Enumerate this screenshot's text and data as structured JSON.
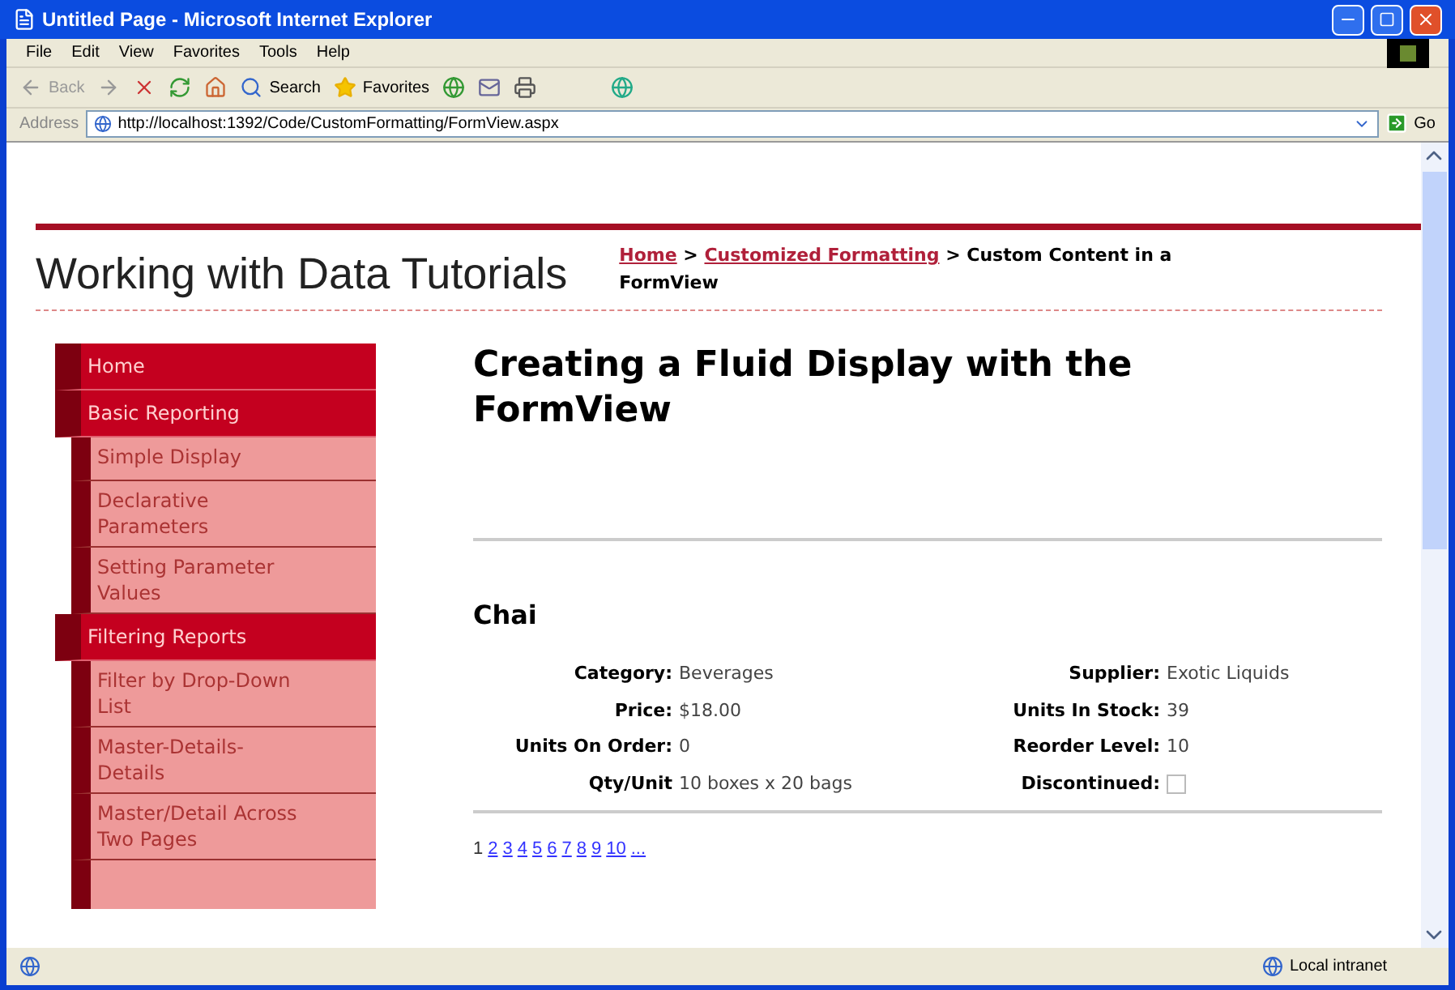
{
  "window": {
    "title": "Untitled Page - Microsoft Internet Explorer"
  },
  "menu_bar": [
    "File",
    "Edit",
    "View",
    "Favorites",
    "Tools",
    "Help"
  ],
  "toolbar": {
    "back": "Back",
    "search": "Search",
    "favorites": "Favorites"
  },
  "address_bar": {
    "label": "Address",
    "url": "http://localhost:1392/Code/CustomFormatting/FormView.aspx",
    "go": "Go"
  },
  "page": {
    "site_title": "Working with Data Tutorials",
    "breadcrumb": {
      "links": [
        "Home",
        "Customized Formatting"
      ],
      "separator": ">",
      "current": "Custom Content in a FormView"
    },
    "sidebar": [
      {
        "label": "Home"
      },
      {
        "label": "Basic Reporting",
        "children": [
          {
            "label": "Simple Display"
          },
          {
            "label": "Declarative Parameters"
          },
          {
            "label": "Setting Parameter Values"
          }
        ]
      },
      {
        "label": "Filtering Reports",
        "children": [
          {
            "label": "Filter by Drop-Down List"
          },
          {
            "label": "Master-Details-Details"
          },
          {
            "label": "Master/Detail Across Two Pages"
          }
        ]
      }
    ],
    "heading": "Creating a Fluid Display with the FormView",
    "product_name": "Chai",
    "fields": [
      {
        "label": "Category:",
        "value": "Beverages",
        "kind": "text"
      },
      {
        "label": "Supplier:",
        "value": "Exotic Liquids",
        "kind": "text"
      },
      {
        "label": "Price:",
        "value": "$18.00",
        "kind": "text"
      },
      {
        "label": "Units In Stock:",
        "value": "39",
        "kind": "text"
      },
      {
        "label": "Units On Order:",
        "value": "0",
        "kind": "text"
      },
      {
        "label": "Reorder Level:",
        "value": "10",
        "kind": "text"
      },
      {
        "label": "Qty/Unit",
        "value": "10 boxes x 20 bags",
        "kind": "text"
      },
      {
        "label": "Discontinued:",
        "checked": false,
        "kind": "checkbox"
      }
    ],
    "pager": [
      {
        "label": "1",
        "selected": true
      },
      {
        "label": "2",
        "selected": false
      },
      {
        "label": "3",
        "selected": false
      },
      {
        "label": "4",
        "selected": false
      },
      {
        "label": "5",
        "selected": false
      },
      {
        "label": "6",
        "selected": false
      },
      {
        "label": "7",
        "selected": false
      },
      {
        "label": "8",
        "selected": false
      },
      {
        "label": "9",
        "selected": false
      },
      {
        "label": "10",
        "selected": false
      },
      {
        "label": "...",
        "selected": false
      }
    ]
  },
  "status_bar": {
    "zone": "Local intranet"
  }
}
